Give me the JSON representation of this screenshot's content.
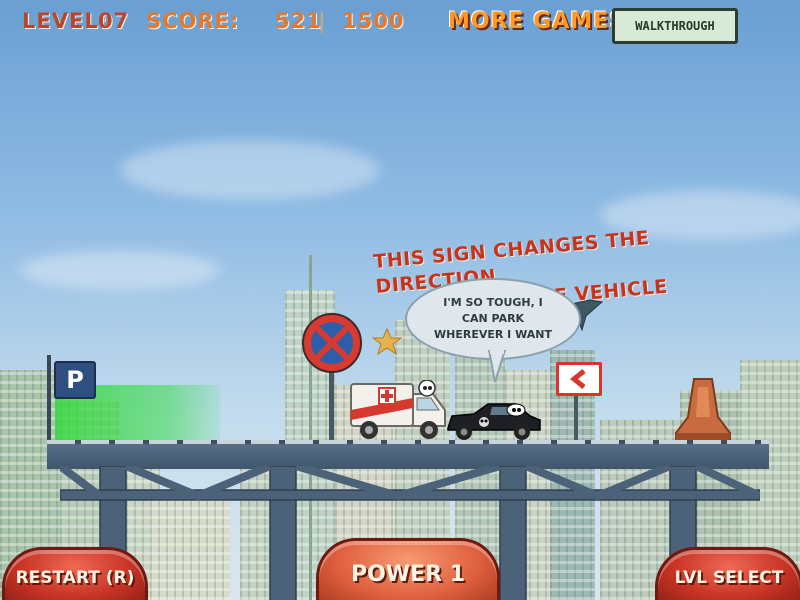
{
  "hud": {
    "level_label": "LEVEL:",
    "level_value": "07",
    "score_label": "SCORE:",
    "score_value": "521",
    "score_separator": "|",
    "score_target": "1500",
    "more_games": "MORE GAMES",
    "walkthrough": "WALKTHROUGH"
  },
  "hint": {
    "line1": "THIS SIGN CHANGES THE DIRECTION",
    "line2": "OF THE VEHICLE"
  },
  "speech_bubble": {
    "line1": "I'M SO TOUGH, I",
    "line2": "CAN PARK",
    "line3": "WHEREVER I WANT"
  },
  "parking_sign": "P",
  "buttons": {
    "restart": "RESTART (R)",
    "power": "POWER 1",
    "level_select": "LVL SELECT"
  },
  "colors": {
    "sky_top": "#6a9fd3",
    "accent_red": "#c7331d",
    "accent_orange": "#e07a31",
    "bridge_steel": "#4b6279",
    "parking_zone": "#35d93d"
  },
  "icons": {
    "no_parking_sign": "no-stopping-icon",
    "direction_sign": "chevron-left-icon",
    "star": "star-icon"
  }
}
